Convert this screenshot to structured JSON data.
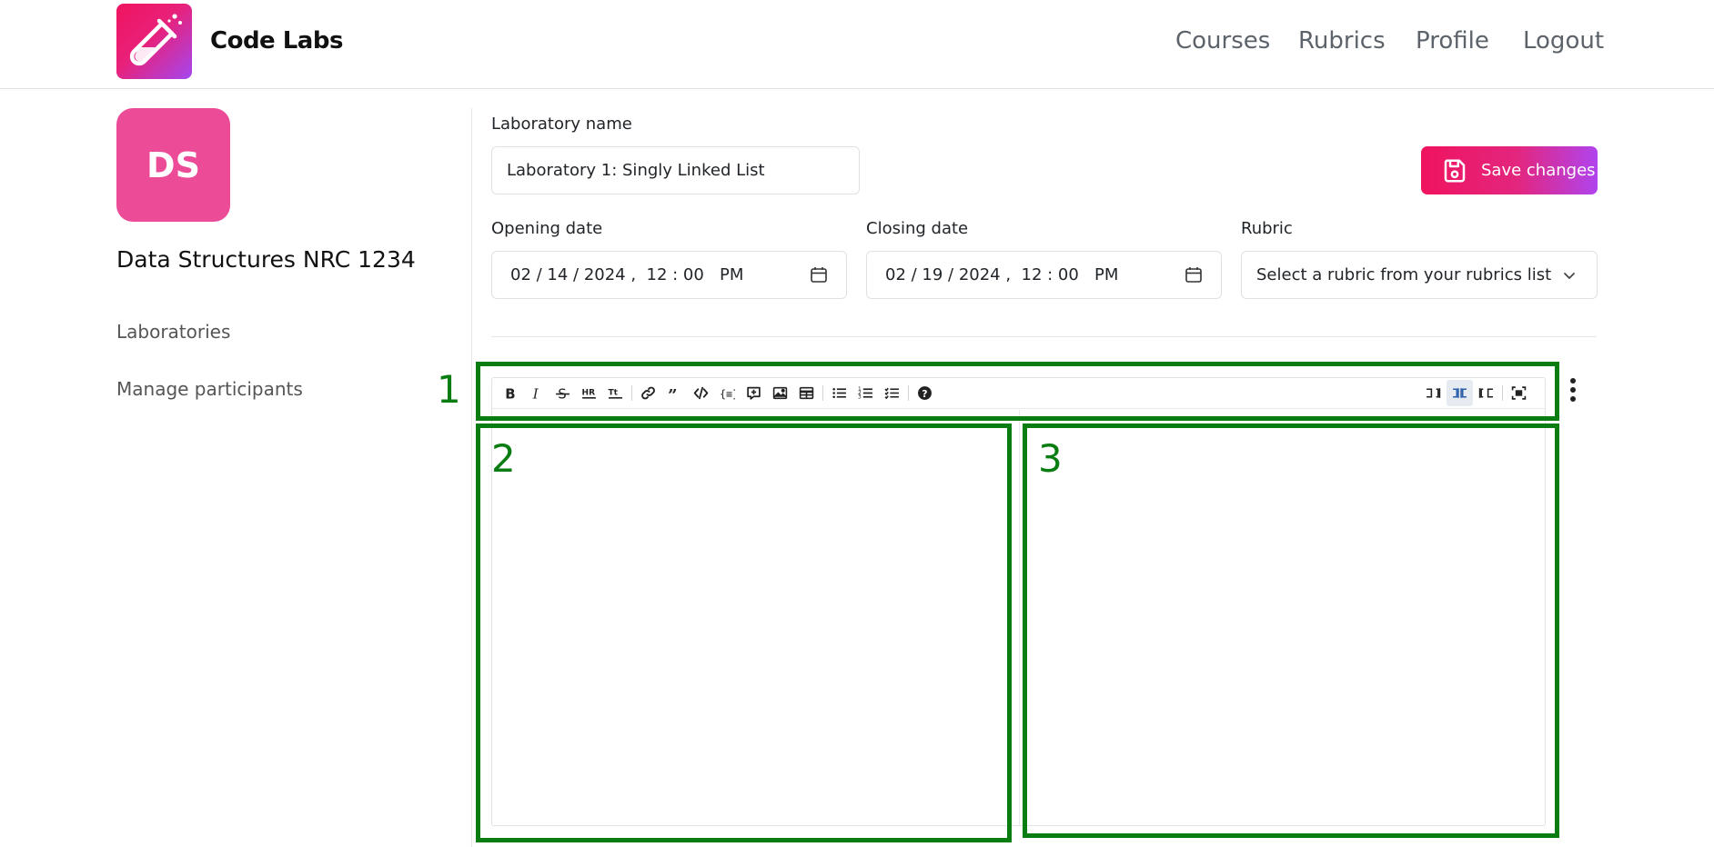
{
  "header": {
    "brand": "Code Labs",
    "nav": [
      "Courses",
      "Rubrics",
      "Profile",
      "Logout"
    ]
  },
  "sidebar": {
    "avatar_initials": "DS",
    "course_title": "Data Structures NRC 1234",
    "links": [
      "Laboratories",
      "Manage participants"
    ]
  },
  "form": {
    "lab_name_label": "Laboratory name",
    "lab_name_value": "Laboratory 1: Singly Linked List",
    "save_label": "Save changes",
    "opening_label": "Opening date",
    "opening_value": "02 / 14 / 2024 ,  12 : 00   PM",
    "closing_label": "Closing date",
    "closing_value": "02 / 19 / 2024 ,  12 : 00   PM",
    "rubric_label": "Rubric",
    "rubric_value": "Select a rubric from your rubrics list"
  },
  "editor": {
    "toolbar_left": [
      "bold-icon",
      "italic-icon",
      "strikethrough-icon",
      "horizontal-rule-icon",
      "title-icon",
      "|",
      "link-icon",
      "quote-icon",
      "code-icon",
      "code-block-icon",
      "comment-icon",
      "image-icon",
      "table-icon",
      "|",
      "unordered-list-icon",
      "ordered-list-icon",
      "checklist-icon",
      "|",
      "help-icon"
    ],
    "toolbar_right": [
      "edit-mode-icon",
      "split-mode-icon",
      "preview-mode-icon",
      "|",
      "fullscreen-icon"
    ]
  },
  "annotations": [
    "1",
    "2",
    "3"
  ],
  "colors": {
    "accent_from": "#f0135f",
    "accent_to": "#b044ee",
    "avatar": "#ec4b98",
    "annotation": "#0a7d12"
  }
}
